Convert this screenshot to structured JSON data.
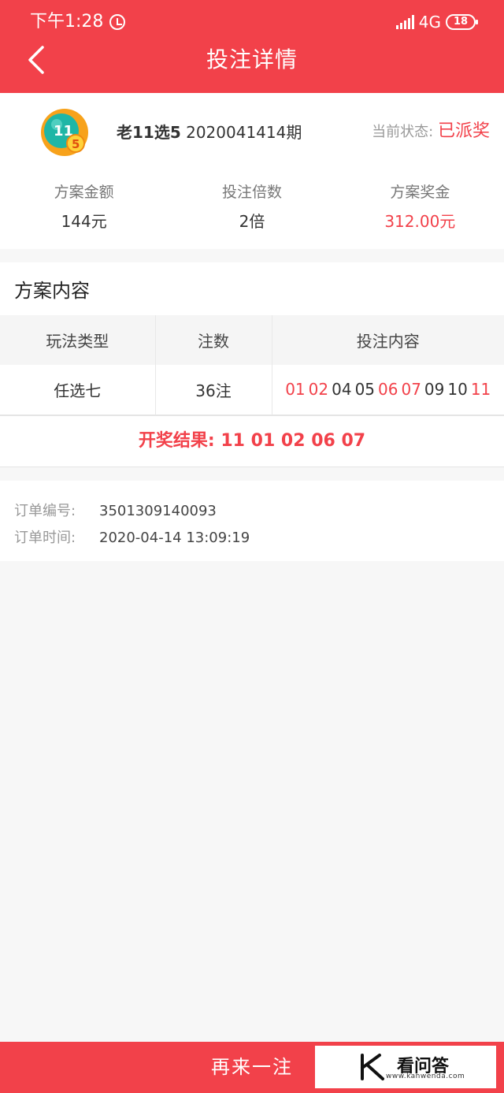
{
  "status_bar": {
    "time": "下午1:28",
    "network": "4G",
    "battery": "18"
  },
  "nav": {
    "title": "投注详情"
  },
  "summary": {
    "lottery_name": "老11选5",
    "issue": "2020041414期",
    "state_label": "当前状态:",
    "state_value": "已派奖",
    "stats": [
      {
        "label": "方案金额",
        "value": "144元"
      },
      {
        "label": "投注倍数",
        "value": "2倍"
      },
      {
        "label": "方案奖金",
        "value": "312.00元"
      }
    ]
  },
  "plan": {
    "title": "方案内容",
    "headers": [
      "玩法类型",
      "注数",
      "投注内容"
    ],
    "row": {
      "type": "任选七",
      "count": "36注",
      "numbers": [
        "01",
        "02",
        "04",
        "05",
        "06",
        "07",
        "09",
        "10",
        "11"
      ],
      "hit_numbers": [
        "01",
        "02",
        "06",
        "07",
        "11"
      ]
    },
    "draw_result_label": "开奖结果:",
    "draw_result_numbers": "11 01 02 06 07"
  },
  "order": {
    "id_label": "订单编号:",
    "id_value": "3501309140093",
    "time_label": "订单时间:",
    "time_value": "2020-04-14 13:09:19"
  },
  "bottom": {
    "again_label": "再来一注"
  },
  "watermark": {
    "text": "看问答",
    "url": "www.kanwenda.com"
  },
  "colors": {
    "brand": "#f2414a",
    "text": "#333333",
    "muted": "#999999"
  },
  "icons": [
    "back-icon",
    "alarm-icon",
    "signal-icon",
    "battery-icon",
    "lottery-ball-icon"
  ]
}
